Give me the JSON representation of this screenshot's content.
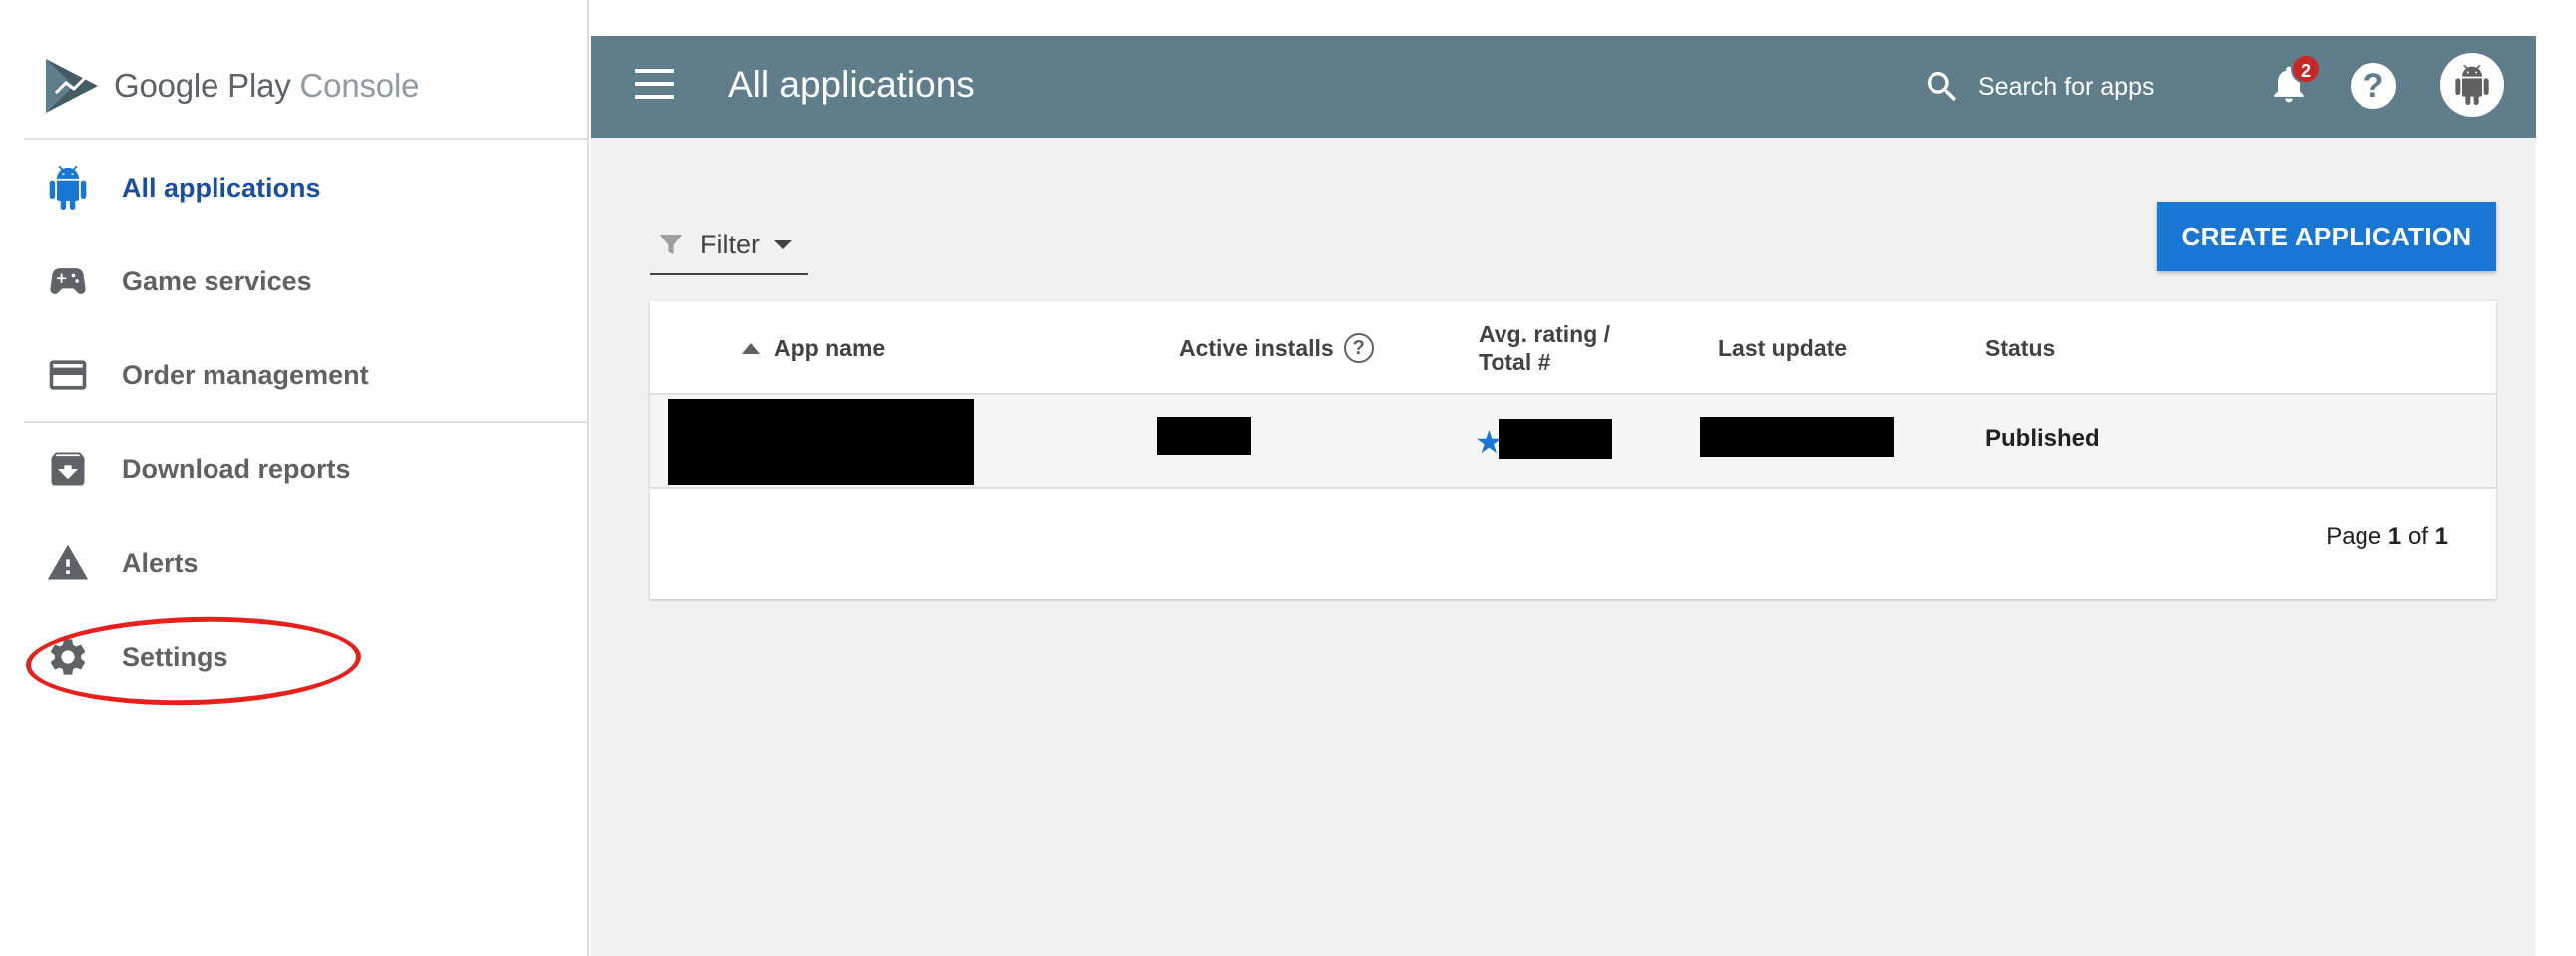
{
  "logo": {
    "brand": "Google Play",
    "product": "Console"
  },
  "sidebar": {
    "items": [
      {
        "label": "All applications",
        "icon": "android-icon",
        "active": true
      },
      {
        "label": "Game services",
        "icon": "gamepad-icon",
        "active": false
      },
      {
        "label": "Order management",
        "icon": "credit-card-icon",
        "active": false
      },
      {
        "label": "Download reports",
        "icon": "download-box-icon",
        "active": false
      },
      {
        "label": "Alerts",
        "icon": "warning-icon",
        "active": false
      },
      {
        "label": "Settings",
        "icon": "gear-icon",
        "active": false
      }
    ]
  },
  "header": {
    "title": "All applications",
    "search_placeholder": "Search for apps",
    "notification_count": "2",
    "help_label": "?"
  },
  "toolbar": {
    "filter_label": "Filter",
    "create_label": "CREATE APPLICATION"
  },
  "table": {
    "columns": {
      "app_name": "App name",
      "active_installs": "Active installs",
      "avg_rating_line1": "Avg. rating /",
      "avg_rating_line2": "Total #",
      "last_update": "Last update",
      "status": "Status"
    },
    "rows": [
      {
        "status": "Published"
      }
    ]
  },
  "pagination": {
    "prefix": "Page",
    "current": "1",
    "sep": "of",
    "total": "1"
  },
  "colors": {
    "topbar": "#607d8b",
    "accent": "#1976d2",
    "active_text": "#1a4f9c",
    "badge": "#c62828",
    "annotation": "#e8201c"
  }
}
